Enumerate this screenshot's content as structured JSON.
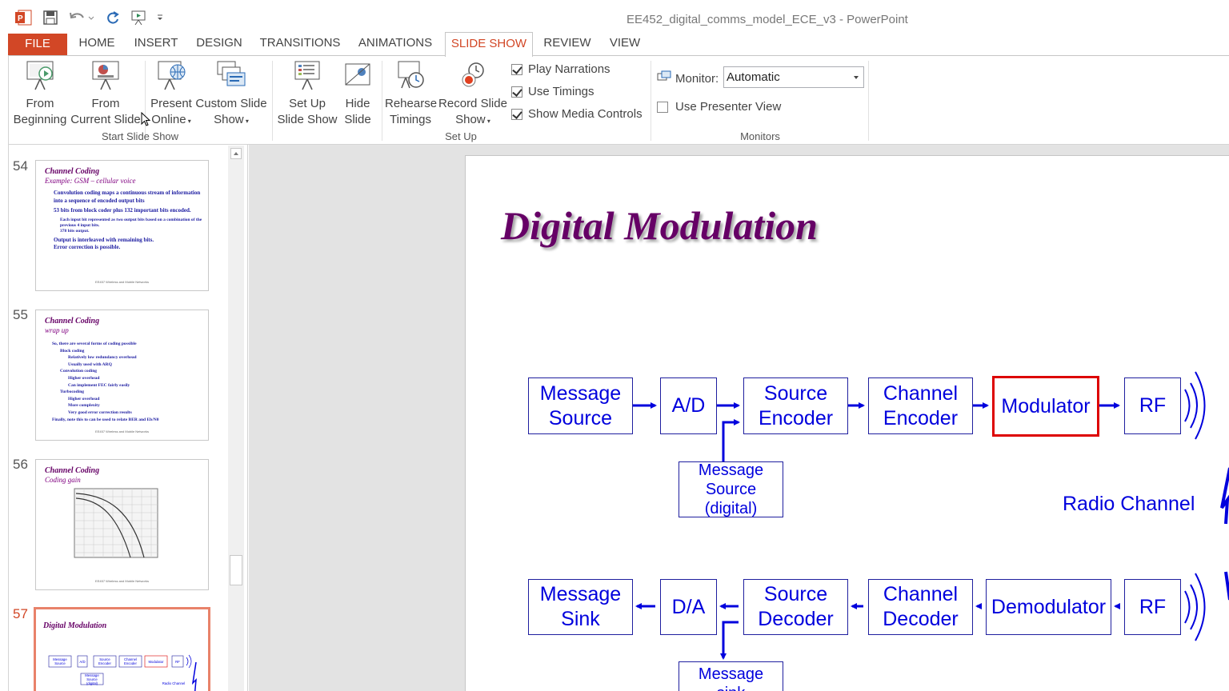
{
  "window": {
    "title": "EE452_digital_comms_model_ECE_v3 - PowerPoint"
  },
  "quick_access": {
    "icons": [
      "powerpoint-logo-icon",
      "save-icon",
      "undo-icon",
      "redo-icon",
      "present-icon",
      "customize-qat-icon"
    ]
  },
  "tabs": [
    {
      "label": "FILE"
    },
    {
      "label": "HOME"
    },
    {
      "label": "INSERT"
    },
    {
      "label": "DESIGN"
    },
    {
      "label": "TRANSITIONS"
    },
    {
      "label": "ANIMATIONS"
    },
    {
      "label": "SLIDE SHOW"
    },
    {
      "label": "REVIEW"
    },
    {
      "label": "VIEW"
    }
  ],
  "active_tab": "SLIDE SHOW",
  "ribbon": {
    "start_group": {
      "label": "Start Slide Show",
      "from_beginning": [
        "From",
        "Beginning"
      ],
      "from_current": [
        "From",
        "Current Slide"
      ],
      "present_online": [
        "Present",
        "Online"
      ],
      "custom_show": [
        "Custom Slide",
        "Show"
      ]
    },
    "setup_group": {
      "label": "Set Up",
      "setup_show": [
        "Set Up",
        "Slide Show"
      ],
      "hide_slide": [
        "Hide",
        "Slide"
      ],
      "rehearse": [
        "Rehearse",
        "Timings"
      ],
      "record": [
        "Record Slide",
        "Show"
      ],
      "play_narrations": "Play Narrations",
      "use_timings": "Use Timings",
      "show_media": "Show Media Controls"
    },
    "monitors_group": {
      "label": "Monitors",
      "monitor_label": "Monitor:",
      "monitor_value": "Automatic",
      "presenter_view": "Use Presenter View"
    }
  },
  "thumbnails": [
    {
      "number": "54",
      "title": "Channel Coding",
      "subtitle": "Example: GSM – cellular voice",
      "lines": [
        "Convolution coding maps a continuous stream of information into a sequence of encoded output bits",
        "53 bits from block coder plus 132 important bits encoded.",
        "Each input bit represented as two output bits based on a combination of the previous 4 input bits.",
        "378 bits output.",
        "Output is interleaved with remaining bits.",
        "Error correction is possible."
      ],
      "footer": "EE457 Wireless and Mobile Networks"
    },
    {
      "number": "55",
      "title": "Channel Coding",
      "subtitle": "wrap up",
      "lines": [
        "So, there are several forms of coding possible",
        "Block coding",
        "Relatively low redundancy overhead",
        "Usually used with ARQ",
        "Convolution coding",
        "Higher overhead",
        "Can implement FEC fairly easily",
        "Turbocoding",
        "Higher overhead",
        "More complexity",
        "Very good error correction results",
        "Finally, note this to can be used to relate BER and Eb/N0"
      ],
      "footer": "EE457 Wireless and Mobile Networks"
    },
    {
      "number": "56",
      "title": "Channel Coding",
      "subtitle": "Coding gain",
      "lines": [],
      "footer": "EE457 Wireless and Mobile Networks"
    },
    {
      "number": "57",
      "title": "Digital Modulation",
      "subtitle": "",
      "lines": [],
      "footer": ""
    }
  ],
  "slide": {
    "title": "Digital Modulation",
    "tx_row": [
      "Message Source",
      "A/D",
      "Source Encoder",
      "Channel Encoder",
      "Modulator",
      "RF"
    ],
    "tx_extra": "Message Source (digital)",
    "radio_label": "Radio Channel",
    "rx_row": [
      "Message Sink",
      "D/A",
      "Source Decoder",
      "Channel Decoder",
      "Demodulator",
      "RF"
    ],
    "rx_extra": "Message sink",
    "highlight_color": "#dd0000",
    "block_text_color": "#0000dd"
  }
}
